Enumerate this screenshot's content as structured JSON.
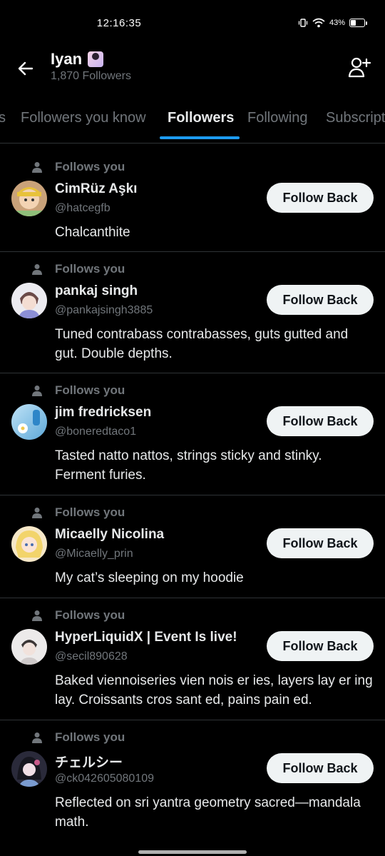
{
  "status": {
    "time": "12:16:35",
    "battery": "43%",
    "battery_level": 0.43
  },
  "header": {
    "title": "Iyan",
    "subtitle": "1,870 Followers"
  },
  "tabs": [
    {
      "label": "Subscriptions"
    },
    {
      "label": "Followers you know"
    },
    {
      "label": "Followers"
    },
    {
      "label": "Following"
    },
    {
      "label": "Subscriptions"
    }
  ],
  "followers": [
    {
      "follows_label": "Follows you",
      "name": "CimRüz Aşkı",
      "handle": "@hatcegfb",
      "bio": "Chalcanthite",
      "button": "Follow Back"
    },
    {
      "follows_label": "Follows you",
      "name": "pankaj singh",
      "handle": "@pankajsingh3885",
      "bio": "Tuned contrabass contrabasses, guts gutted and gut. Double depths.",
      "button": "Follow Back"
    },
    {
      "follows_label": "Follows you",
      "name": "jim fredricksen",
      "handle": "@boneredtaco1",
      "bio": "Tasted natto nattos, strings sticky and stinky. Ferment furies.",
      "button": "Follow Back"
    },
    {
      "follows_label": "Follows you",
      "name": "Micaelly Nicolina",
      "handle": "@Micaelly_prin",
      "bio": "My cat’s sleeping on my hoodie",
      "button": "Follow Back"
    },
    {
      "follows_label": "Follows you",
      "name": "HyperLiquidX | Event Is live!",
      "handle": "@secil890628",
      "bio": "Baked viennoiseries vien nois er ies, layers lay er ing lay. Croissants cros sant ed, pains pain ed.",
      "button": "Follow Back"
    },
    {
      "follows_label": "Follows you",
      "name": "チェルシー",
      "handle": "@ck042605080109",
      "bio": "Reflected on sri yantra geometry sacred—mandala math.",
      "button": "Follow Back"
    }
  ]
}
